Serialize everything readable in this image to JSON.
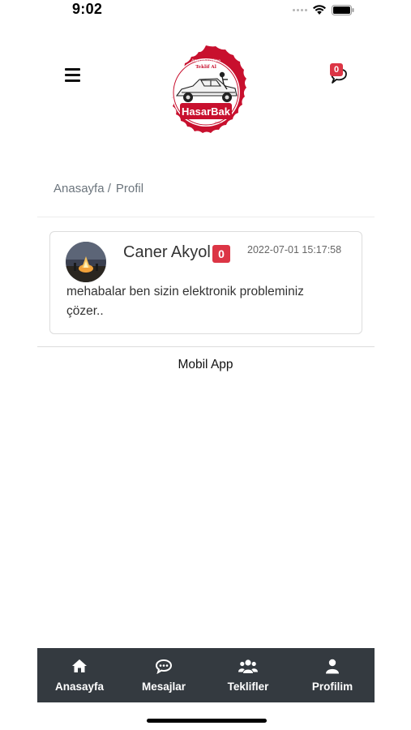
{
  "status_bar": {
    "time": "9:02"
  },
  "header": {
    "logo": {
      "top_text": "Anında Online",
      "middle_text": "Teklif Al",
      "brand": "HasarBak",
      "sub": ".com"
    },
    "message_count": "0"
  },
  "breadcrumb": {
    "home": "Anasayfa /",
    "current": "Profil"
  },
  "message_card": {
    "user_name": "Caner Akyol",
    "badge_count": "0",
    "timestamp": "2022-07-01 15:17:58",
    "text": "mehabalar ben sizin elektronik probleminiz çözer.."
  },
  "footer": {
    "text": "Mobil App"
  },
  "bottom_nav": {
    "items": [
      {
        "label": "Anasayfa",
        "icon": "home-icon"
      },
      {
        "label": "Mesajlar",
        "icon": "chat-icon"
      },
      {
        "label": "Teklifler",
        "icon": "users-icon"
      },
      {
        "label": "Profilim",
        "icon": "user-icon"
      }
    ]
  },
  "colors": {
    "accent": "#dc3545",
    "nav_bg": "#343a40",
    "logo_red": "#c8102e"
  }
}
